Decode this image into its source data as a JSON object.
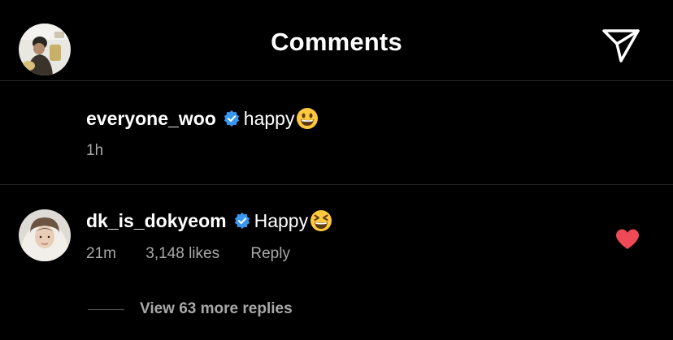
{
  "header": {
    "title": "Comments",
    "back_icon": "chevron-left-icon",
    "share_icon": "paper-plane-icon"
  },
  "caption": {
    "username": "everyone_woo",
    "text": "happy",
    "emoji": "grinning-face-with-smiling-eyes",
    "time": "1h",
    "verified": true
  },
  "comment": {
    "username": "dk_is_dokyeom",
    "text": "Happy",
    "emoji": "grinning-squinting-face",
    "time": "21m",
    "likes": "3,148 likes",
    "reply_label": "Reply",
    "liked": true,
    "like_color": "#ed4956",
    "verified": true
  },
  "replies": {
    "label": "View 63 more replies"
  },
  "colors": {
    "background": "#000000",
    "text": "#ffffff",
    "secondary": "#a8a8a8",
    "verified_badge": "#3897f0",
    "divider": "#262626"
  }
}
